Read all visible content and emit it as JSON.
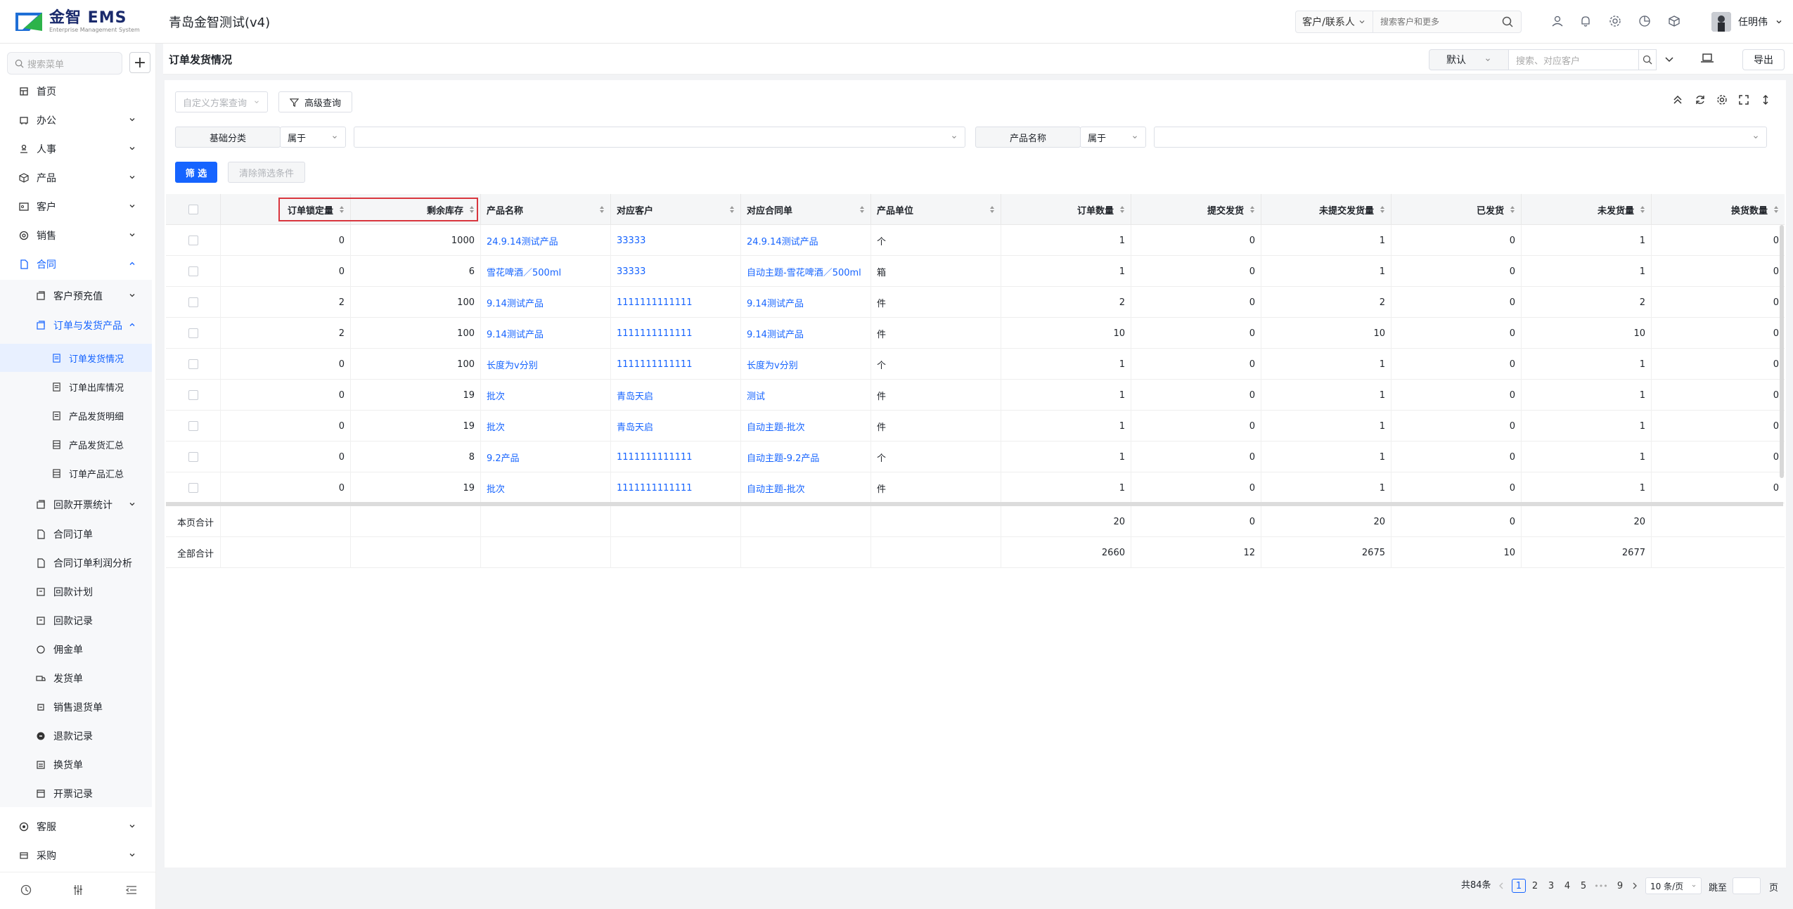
{
  "app": {
    "logo_text": "金智 EMS",
    "logo_sub": "Enterprise Management System",
    "title": "青岛金智测试(v4)"
  },
  "topbar": {
    "search_scope": "客户/联系人",
    "search_placeholder": "搜索客户和更多",
    "user_name": "任明伟"
  },
  "sidebar": {
    "search_placeholder": "搜索菜单",
    "items": [
      {
        "label": "首页",
        "icon": "home-icon"
      },
      {
        "label": "办公",
        "icon": "office-icon"
      },
      {
        "label": "人事",
        "icon": "people-icon"
      },
      {
        "label": "产品",
        "icon": "box-icon"
      },
      {
        "label": "客户",
        "icon": "customer-icon"
      },
      {
        "label": "销售",
        "icon": "sales-icon"
      },
      {
        "label": "合同",
        "icon": "contract-icon"
      }
    ],
    "contract_children": [
      {
        "label": "客户预充值"
      },
      {
        "label": "订单与发货产品"
      }
    ],
    "order_children": [
      {
        "label": "订单发货情况"
      },
      {
        "label": "订单出库情况"
      },
      {
        "label": "产品发货明细"
      },
      {
        "label": "产品发货汇总"
      },
      {
        "label": "订单产品汇总"
      }
    ],
    "contract_more": [
      {
        "label": "回款开票统计"
      },
      {
        "label": "合同订单"
      },
      {
        "label": "合同订单利润分析"
      },
      {
        "label": "回款计划"
      },
      {
        "label": "回款记录"
      },
      {
        "label": "佣金单"
      },
      {
        "label": "发货单"
      },
      {
        "label": "销售退货单"
      },
      {
        "label": "退款记录"
      },
      {
        "label": "换货单"
      },
      {
        "label": "开票记录"
      }
    ],
    "bottom_items": [
      {
        "label": "客服"
      },
      {
        "label": "采购"
      }
    ]
  },
  "page": {
    "title": "订单发货情况",
    "view_select": "默认",
    "search_placeholder": "搜索、对应客户",
    "export_label": "导出",
    "scheme_placeholder": "自定义方案查询",
    "advanced_label": "高级查询",
    "filter1_label": "基础分类",
    "filter1_op": "属于",
    "filter2_label": "产品名称",
    "filter2_op": "属于",
    "filter_btn": "筛 选",
    "clear_btn": "清除筛选条件"
  },
  "table": {
    "headers": [
      "订单锁定量",
      "剩余库存",
      "产品名称",
      "对应客户",
      "对应合同单",
      "产品单位",
      "订单数量",
      "提交发货",
      "未提交发货量",
      "已发货",
      "未发货量",
      "换货数量"
    ],
    "rows": [
      [
        "0",
        "1000",
        "24.9.14测试产品",
        "33333",
        "24.9.14测试产品",
        "个",
        "1",
        "0",
        "1",
        "0",
        "1",
        "0"
      ],
      [
        "0",
        "6",
        "雪花啤酒／500ml",
        "33333",
        "自动主题-雪花啤酒／500ml",
        "箱",
        "1",
        "0",
        "1",
        "0",
        "1",
        "0"
      ],
      [
        "2",
        "100",
        "9.14测试产品",
        "1111111111111",
        "9.14测试产品",
        "件",
        "2",
        "0",
        "2",
        "0",
        "2",
        "0"
      ],
      [
        "2",
        "100",
        "9.14测试产品",
        "1111111111111",
        "9.14测试产品",
        "件",
        "10",
        "0",
        "10",
        "0",
        "10",
        "0"
      ],
      [
        "0",
        "100",
        "长度为v分别",
        "1111111111111",
        "长度为v分别",
        "个",
        "1",
        "0",
        "1",
        "0",
        "1",
        "0"
      ],
      [
        "0",
        "19",
        "批次",
        "青岛天启",
        "测试",
        "件",
        "1",
        "0",
        "1",
        "0",
        "1",
        "0"
      ],
      [
        "0",
        "19",
        "批次",
        "青岛天启",
        "自动主题-批次",
        "件",
        "1",
        "0",
        "1",
        "0",
        "1",
        "0"
      ],
      [
        "0",
        "8",
        "9.2产品",
        "1111111111111",
        "自动主题-9.2产品",
        "个",
        "1",
        "0",
        "1",
        "0",
        "1",
        "0"
      ],
      [
        "0",
        "19",
        "批次",
        "1111111111111",
        "自动主题-批次",
        "件",
        "1",
        "0",
        "1",
        "0",
        "1",
        "0"
      ]
    ],
    "summary": [
      {
        "label": "本页合计",
        "values": [
          "20",
          "0",
          "20",
          "0",
          "20"
        ]
      },
      {
        "label": "全部合计",
        "values": [
          "2660",
          "12",
          "2675",
          "10",
          "2677"
        ]
      }
    ]
  },
  "pagination": {
    "total": "共84条",
    "pages": [
      "1",
      "2",
      "3",
      "4",
      "5",
      "9"
    ],
    "ellipsis": "•••",
    "page_size": "10 条/页",
    "jump_label": "跳至",
    "page_suffix": "页"
  },
  "colors": {
    "primary": "#1664ff",
    "highlight": "#d9363e"
  }
}
